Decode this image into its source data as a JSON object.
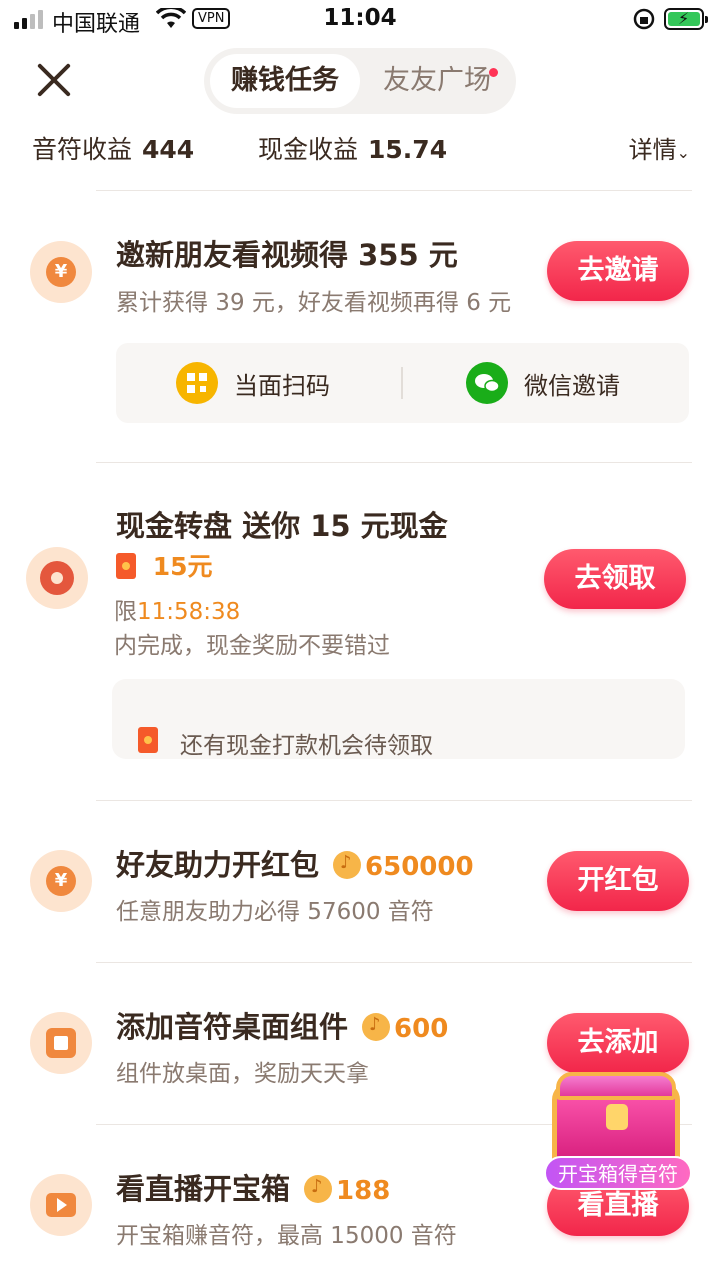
{
  "status_bar": {
    "carrier": "中国联通",
    "vpn": "VPN",
    "time": "11:04"
  },
  "header": {
    "tabs": [
      {
        "label": "赚钱任务",
        "active": true
      },
      {
        "label": "友友广场",
        "active": false,
        "has_dot": true
      }
    ]
  },
  "earnings": {
    "notes_label": "音符收益",
    "notes_value": "444",
    "cash_label": "现金收益",
    "cash_value": "15.74",
    "detail_label": "详情"
  },
  "tasks": [
    {
      "title": "邀新朋友看视频得 355 元",
      "subtitle": "累计获得 39 元，好友看视频再得 6 元",
      "button": "去邀请",
      "icon": "yuan-icon",
      "share_options": [
        {
          "label": "当面扫码",
          "icon": "qr-code-icon"
        },
        {
          "label": "微信邀请",
          "icon": "wechat-icon"
        }
      ]
    },
    {
      "title": "现金转盘 送你 15 元现金",
      "reward": "15元",
      "limit_prefix": "限",
      "limit_time": "11:58:38",
      "subtitle": "内完成，现金奖励不要错过",
      "button": "去领取",
      "icon": "wheel-icon",
      "notice": "还有现金打款机会待领取"
    },
    {
      "title": "好友助力开红包",
      "reward": "650000",
      "subtitle": "任意朋友助力必得 57600 音符",
      "button": "开红包",
      "icon": "yuan-icon"
    },
    {
      "title": "添加音符桌面组件",
      "reward": "600",
      "subtitle": "组件放桌面，奖励天天拿",
      "button": "去添加",
      "icon": "widget-icon"
    },
    {
      "title": "看直播开宝箱",
      "reward": "188",
      "subtitle": "开宝箱赚音符，最高 15000 音符",
      "button": "看直播",
      "icon": "tv-icon"
    }
  ],
  "floating_chest": {
    "label": "开宝箱得音符"
  },
  "colors": {
    "accent_button": "#f2264a",
    "reward_orange": "#ef8a1f",
    "icon_bg": "#fde4cf"
  }
}
